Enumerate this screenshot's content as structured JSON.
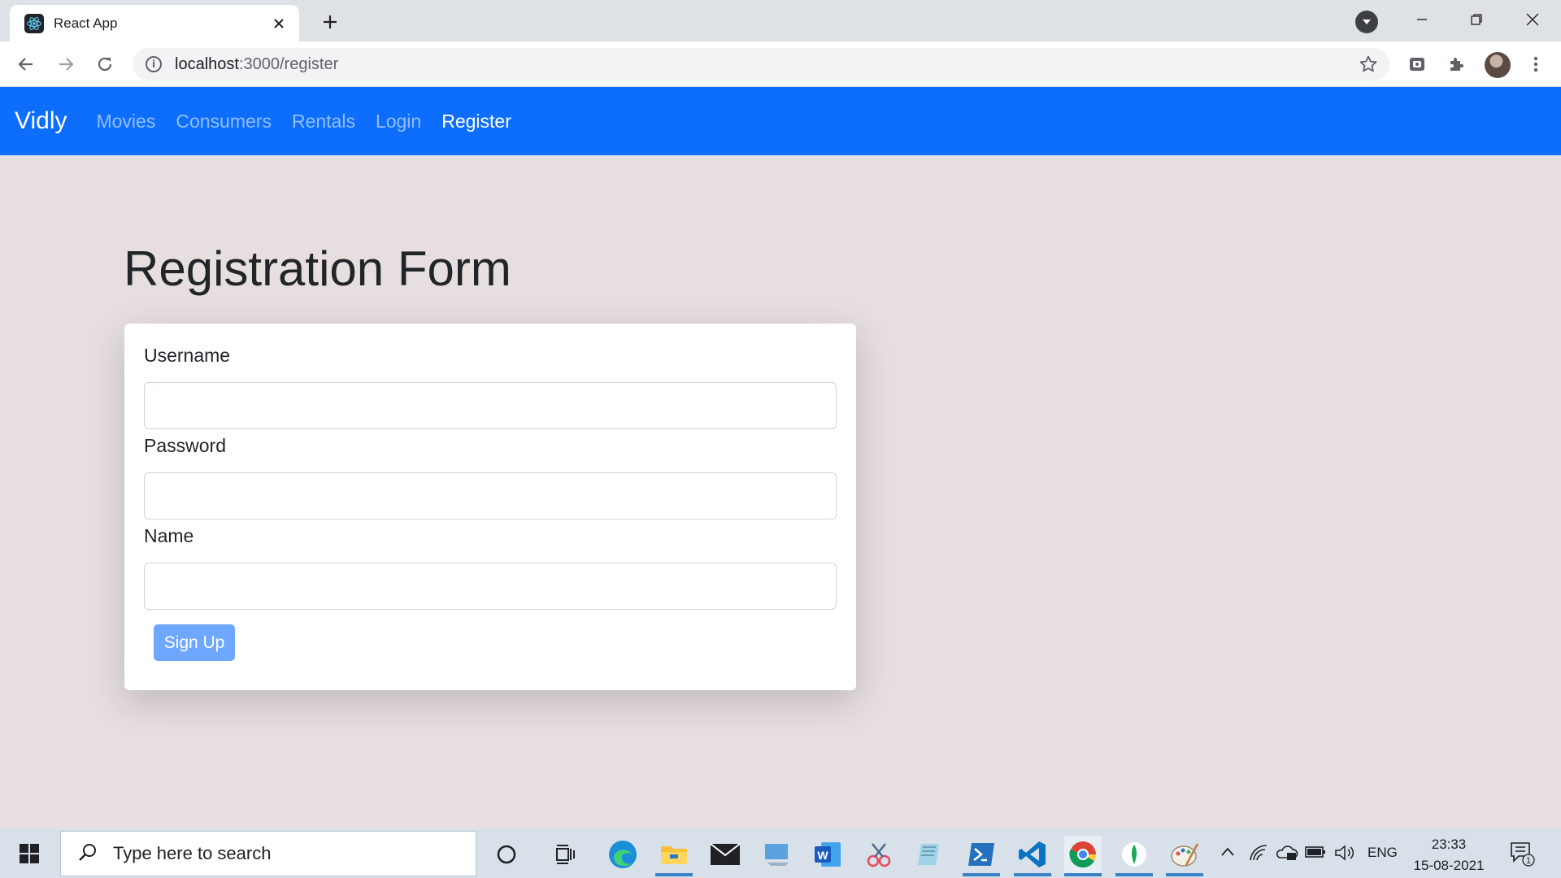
{
  "browser": {
    "tab_title": "React App",
    "url_host": "localhost",
    "url_path": ":3000/register"
  },
  "navbar": {
    "brand": "Vidly",
    "links": [
      {
        "label": "Movies",
        "active": false
      },
      {
        "label": "Consumers",
        "active": false
      },
      {
        "label": "Rentals",
        "active": false
      },
      {
        "label": "Login",
        "active": false
      },
      {
        "label": "Register",
        "active": true
      }
    ],
    "color": "#0d6efd"
  },
  "page": {
    "title": "Registration Form",
    "background": "#e7dfdf"
  },
  "form": {
    "fields": [
      {
        "label": "Username",
        "value": ""
      },
      {
        "label": "Password",
        "value": ""
      },
      {
        "label": "Name",
        "value": ""
      }
    ],
    "submit_label": "Sign Up",
    "submit_color": "#6ea8fe"
  },
  "taskbar": {
    "search_placeholder": "Type here to search",
    "language": "ENG",
    "time": "23:33",
    "date": "15-08-2021",
    "notification_count": "1",
    "pinned": [
      "cortana-icon",
      "task-view-icon",
      "edge-icon",
      "file-explorer-icon",
      "mail-icon",
      "remote-desktop-icon",
      "word-icon",
      "snipping-tool-icon",
      "notepad-icon",
      "powershell-icon",
      "vscode-icon",
      "chrome-icon",
      "mongodb-compass-icon",
      "paint-icon"
    ]
  }
}
